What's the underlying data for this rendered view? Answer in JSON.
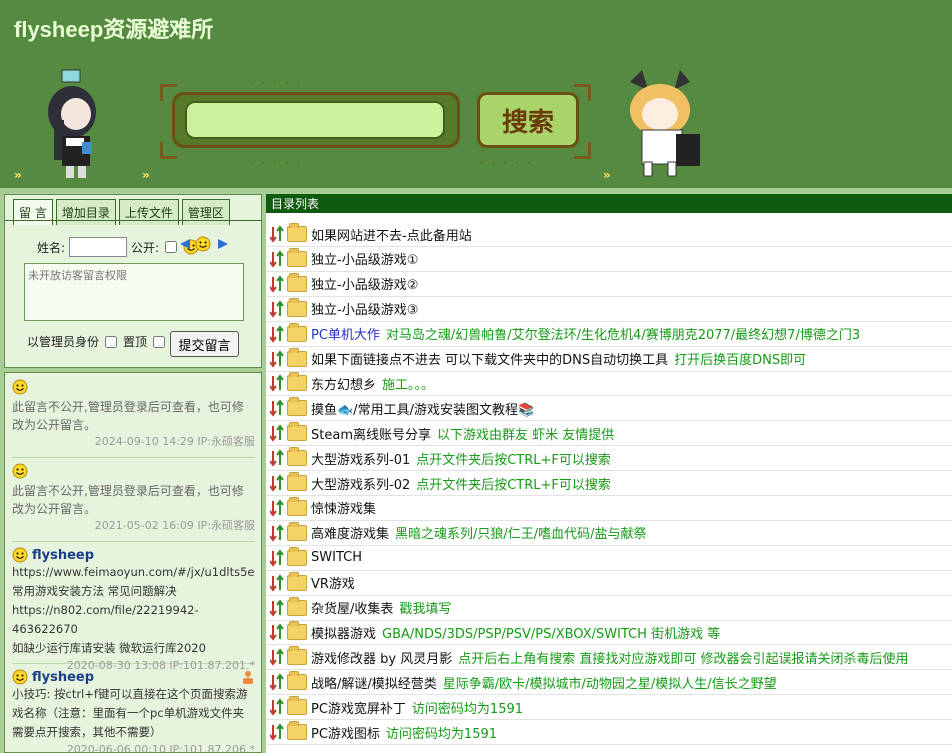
{
  "site": {
    "title": "flysheep资源避难所"
  },
  "search": {
    "button_label": "搜索",
    "placeholder": ""
  },
  "header": {
    "chevrons": [
      "»",
      "»",
      "»"
    ],
    "dots": "· · · · ·"
  },
  "tabs": [
    {
      "label": "留 言",
      "active": true
    },
    {
      "label": "增加目录",
      "active": false
    },
    {
      "label": "上传文件",
      "active": false
    },
    {
      "label": "管理区",
      "active": false
    }
  ],
  "form": {
    "name_label": "姓名:",
    "public_label": "公开:",
    "message_placeholder": "未开放访客留言权限",
    "admin_label": "以管理员身份",
    "pin_label": "置顶",
    "submit_label": "提交留言"
  },
  "comments": [
    {
      "name": "",
      "text": "此留言不公开,管理员登录后可查看，也可修改为公开留言。",
      "meta": "2024-09-10 14:29 IP:永硕客服"
    },
    {
      "name": "",
      "text": "此留言不公开,管理员登录后可查看，也可修改为公开留言。",
      "meta": "2021-05-02 16:09 IP:永硕客服"
    },
    {
      "name": "flysheep",
      "lines": [
        "https://www.feimaoyun.com/#/jx/u1dlts5e",
        "常用游戏安装方法 常见问题解决",
        "https://n802.com/file/22219942-463622670",
        "如缺少运行库请安装 微软运行库2020"
      ],
      "meta": "2020-08-30 13:08 IP:101.87.201.*"
    },
    {
      "name": "flysheep",
      "lines": [
        "小技巧: 按ctrl+f键可以直接在这个页面搜索游",
        "戏名称（注意：里面有一个pc单机游戏文件夹",
        "需要点开搜索，其他不需要）"
      ],
      "meta": "2020-06-06 00:10 IP:101.87.206.*"
    }
  ],
  "list": {
    "header": "目录列表",
    "entries": [
      {
        "name": "如果网站进不去-点此备用站",
        "desc": ""
      },
      {
        "name": "独立-小品级游戏①",
        "desc": ""
      },
      {
        "name": "独立-小品级游戏②",
        "desc": ""
      },
      {
        "name": "独立-小品级游戏③",
        "desc": ""
      },
      {
        "name": "PC单机大作",
        "desc": "对马岛之魂/幻兽帕鲁/艾尔登法环/生化危机4/赛博朋克2077/最终幻想7/博德之门3",
        "blue": true
      },
      {
        "name": "如果下面链接点不进去 可以下载文件夹中的DNS自动切换工具",
        "desc": "打开后换百度DNS即可"
      },
      {
        "name": "东方幻想乡",
        "desc": "施工。。。"
      },
      {
        "name": "摸鱼🐟/常用工具/游戏安装图文教程📚",
        "desc": ""
      },
      {
        "name": "Steam离线账号分享",
        "desc": "以下游戏由群友 虾米 友情提供"
      },
      {
        "name": "大型游戏系列-01",
        "desc": "点开文件夹后按CTRL+F可以搜索"
      },
      {
        "name": "大型游戏系列-02",
        "desc": "点开文件夹后按CTRL+F可以搜索"
      },
      {
        "name": "惊悚游戏集",
        "desc": ""
      },
      {
        "name": "高难度游戏集",
        "desc": "黑暗之魂系列/只狼/仁王/嗜血代码/盐与献祭"
      },
      {
        "name": "SWITCH",
        "desc": ""
      },
      {
        "name": "VR游戏",
        "desc": ""
      },
      {
        "name": "杂货屋/收集表",
        "desc": "戳我填写"
      },
      {
        "name": "模拟器游戏",
        "desc": "GBA/NDS/3DS/PSP/PSV/PS/XBOX/SWITCH 街机游戏 等"
      },
      {
        "name": "游戏修改器 by 风灵月影",
        "desc": "点开后右上角有搜索 直接找对应游戏即可 修改器会引起误报请关闭杀毒后使用"
      },
      {
        "name": "战略/解谜/模拟经营类",
        "desc": "星际争霸/欧卡/模拟城市/动物园之星/模拟人生/信长之野望"
      },
      {
        "name": "PC游戏宽屏补丁",
        "desc": "访问密码均为1591"
      },
      {
        "name": "PC游戏图标",
        "desc": "访问密码均为1591"
      }
    ]
  },
  "colors": {
    "header_bg": "#568a40",
    "page_bg": "#a9cd96",
    "list_header_bg": "#0e5a0e",
    "desc_green": "#159b15",
    "blue_link": "#2a2fd0"
  }
}
